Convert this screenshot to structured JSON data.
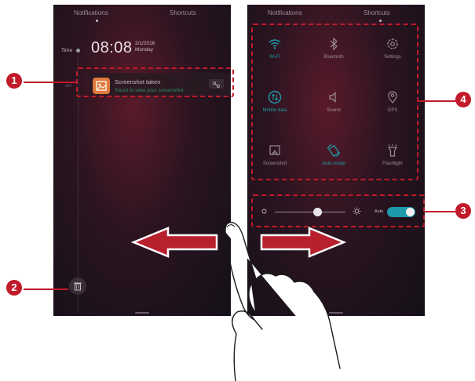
{
  "left_screen": {
    "tabs": [
      {
        "label": "Notifications"
      },
      {
        "label": "Shortcuts"
      }
    ],
    "time_label": "Time",
    "clock": "08:08",
    "date": "2/1/2016",
    "weekday": "Monday",
    "sub_label": "am",
    "notification": {
      "title": "Screenshot taken",
      "subtitle": "Touch to view your screenshot",
      "icon": "image-icon",
      "action_icon": "share-icon"
    },
    "trash_icon": "trash-icon"
  },
  "right_screen": {
    "tabs": [
      {
        "label": "Notifications"
      },
      {
        "label": "Shortcuts"
      }
    ],
    "shortcuts": [
      {
        "label": "Wi-Fi",
        "icon": "wifi-icon",
        "active": true
      },
      {
        "label": "Bluetooth",
        "icon": "bluetooth-icon",
        "active": false
      },
      {
        "label": "Settings",
        "icon": "gear-icon",
        "active": false
      },
      {
        "label": "Mobile data",
        "icon": "mobile-data-icon",
        "active": true
      },
      {
        "label": "Sound",
        "icon": "speaker-icon",
        "active": false
      },
      {
        "label": "GPS",
        "icon": "location-pin-icon",
        "active": false
      },
      {
        "label": "Screenshot",
        "icon": "screenshot-icon",
        "active": false
      },
      {
        "label": "Auto-rotate",
        "icon": "rotate-icon",
        "active": true
      },
      {
        "label": "Flashlight",
        "icon": "flashlight-icon",
        "active": false
      }
    ],
    "brightness": {
      "level": 0.6,
      "auto_label": "Auto",
      "auto_enabled": true
    }
  },
  "callouts": [
    {
      "number": "1"
    },
    {
      "number": "2"
    },
    {
      "number": "3"
    },
    {
      "number": "4"
    }
  ],
  "colors": {
    "annotation": "#c11a2a",
    "active_tile": "#1f9aaa",
    "inactive_tile": "#9a8c96",
    "notification_accent": "#2f8f6a"
  }
}
